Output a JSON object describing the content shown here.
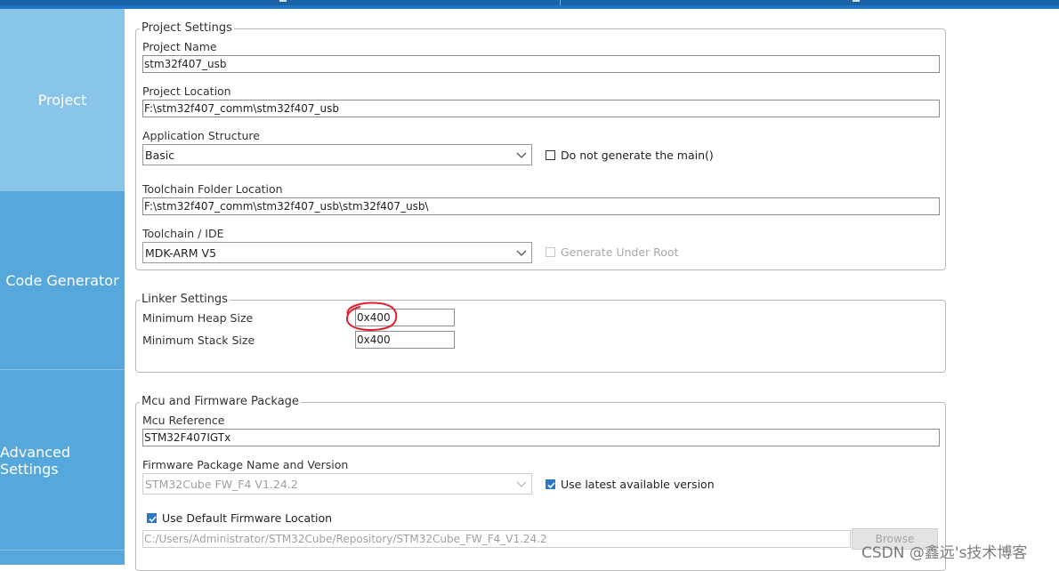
{
  "sidebar": {
    "items": [
      {
        "label": "Project",
        "active": true
      },
      {
        "label": "Code Generator",
        "active": false
      },
      {
        "label": "Advanced Settings",
        "active": false
      }
    ]
  },
  "project_settings": {
    "legend": "Project Settings",
    "project_name": {
      "label": "Project Name",
      "value": "stm32f407_usb"
    },
    "project_location": {
      "label": "Project Location",
      "value": "F:\\stm32f407_comm\\stm32f407_usb"
    },
    "application_structure": {
      "label": "Application Structure",
      "value": "Basic"
    },
    "do_not_generate_main": {
      "label": "Do not generate the main()",
      "checked": false
    },
    "toolchain_folder": {
      "label": "Toolchain Folder Location",
      "value": "F:\\stm32f407_comm\\stm32f407_usb\\stm32f407_usb\\"
    },
    "toolchain_ide": {
      "label": "Toolchain / IDE",
      "value": "MDK-ARM V5"
    },
    "generate_under_root": {
      "label": "Generate Under Root",
      "checked": false,
      "enabled": false
    }
  },
  "linker_settings": {
    "legend": "Linker Settings",
    "min_heap": {
      "label": "Minimum Heap Size",
      "value": "0x400"
    },
    "min_stack": {
      "label": "Minimum Stack Size",
      "value": "0x400"
    }
  },
  "mcu_firmware": {
    "legend": "Mcu and Firmware Package",
    "mcu_reference": {
      "label": "Mcu Reference",
      "value": "STM32F407IGTx"
    },
    "firmware_package": {
      "label": "Firmware Package Name and Version",
      "value": "STM32Cube FW_F4 V1.24.2"
    },
    "use_latest": {
      "label": "Use latest available version",
      "checked": true
    },
    "use_default_location": {
      "label": "Use Default Firmware Location",
      "checked": true
    },
    "firmware_location": {
      "value": "C:/Users/Administrator/STM32Cube/Repository/STM32Cube_FW_F4_V1.24.2"
    },
    "browse_label": "Browse"
  },
  "watermark": "CSDN @鑫远's技术博客",
  "colors": {
    "sidebar": "#55a7dc",
    "sidebar_active": "#88c5e9",
    "topbar": "#1a63a8",
    "checkbox_checked": "#2a79c9",
    "annotation": "#e0202a"
  }
}
